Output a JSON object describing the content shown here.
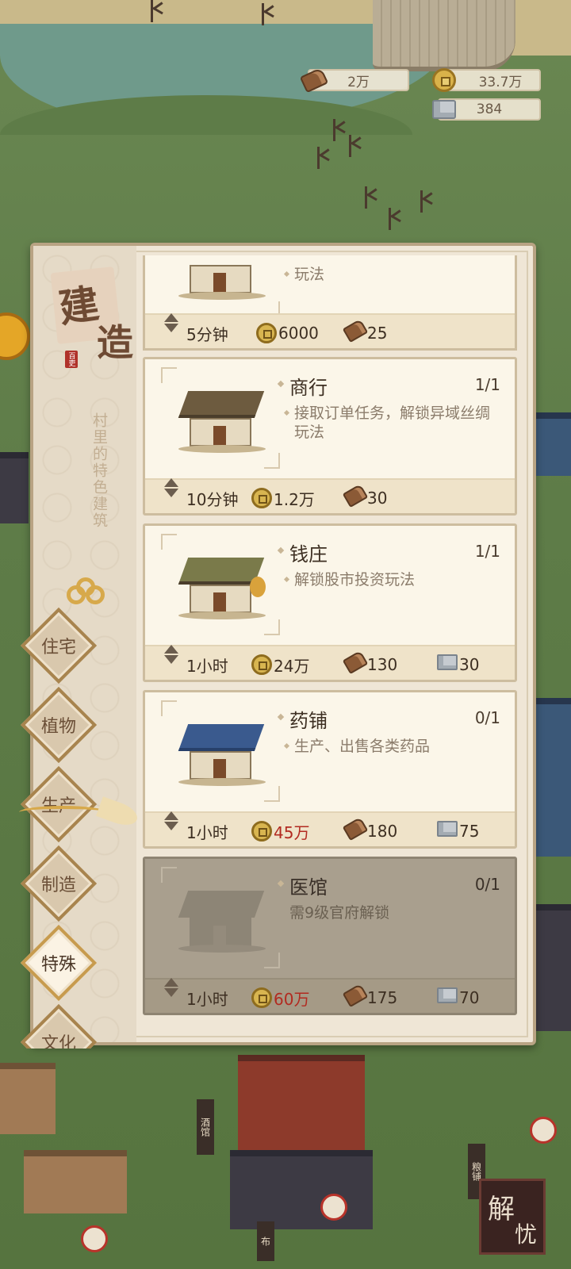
{
  "resources": {
    "wood": "2万",
    "coins": "33.7万",
    "stone": "384"
  },
  "panel": {
    "title_char_1": "建",
    "title_char_2": "造",
    "stamp": "百吏",
    "subtitle": "村里的特色建筑"
  },
  "categories": [
    {
      "label": "住宅",
      "active": false
    },
    {
      "label": "植物",
      "active": false
    },
    {
      "label": "生产",
      "active": false
    },
    {
      "label": "制造",
      "active": false
    },
    {
      "label": "特殊",
      "active": true
    },
    {
      "label": "文化",
      "active": false
    }
  ],
  "partial_card": {
    "desc_tail": "玩法",
    "time": "5分钟",
    "coins": "6000",
    "wood": "25"
  },
  "buildings": [
    {
      "name": "商行",
      "count": "1/1",
      "desc": "接取订单任务，解锁异域丝绸玩法",
      "time": "10分钟",
      "coins": "1.2万",
      "wood": "30",
      "stone": "",
      "locked": false,
      "coins_insufficient": false
    },
    {
      "name": "钱庄",
      "count": "1/1",
      "desc": "解锁股市投资玩法",
      "time": "1小时",
      "coins": "24万",
      "wood": "130",
      "stone": "30",
      "locked": false,
      "coins_insufficient": false
    },
    {
      "name": "药铺",
      "count": "0/1",
      "desc": "生产、出售各类药品",
      "time": "1小时",
      "coins": "45万",
      "wood": "180",
      "stone": "75",
      "locked": false,
      "coins_insufficient": true
    },
    {
      "name": "医馆",
      "count": "0/1",
      "desc": "需9级官府解锁",
      "time": "1小时",
      "coins": "60万",
      "wood": "175",
      "stone": "70",
      "locked": true,
      "coins_insufficient": true
    }
  ],
  "signs": {
    "tavern": "酒馆",
    "grain": "粮铺",
    "cloth": "布"
  },
  "corner_button": {
    "char_1": "解",
    "char_2": "忧"
  },
  "colors": {
    "insufficient": "#b22a20",
    "panel_bg": "#efe6d6",
    "card_bg": "#fbf6e9",
    "locked_bg": "#a99f8e"
  }
}
